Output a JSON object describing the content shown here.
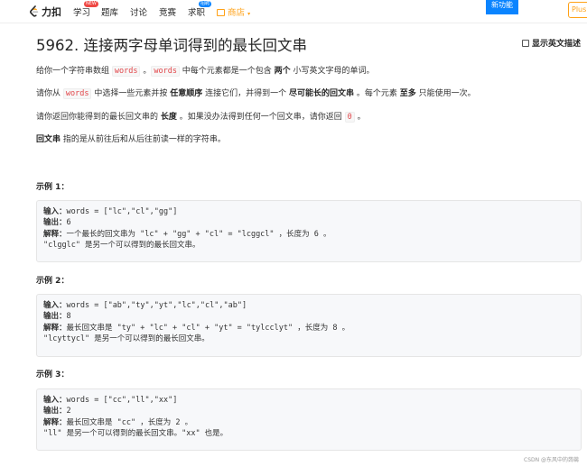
{
  "nav": {
    "logo_text": "力扣",
    "items": [
      {
        "label": "学习",
        "badge": "NEW"
      },
      {
        "label": "题库"
      },
      {
        "label": "讨论"
      },
      {
        "label": "竞赛"
      },
      {
        "label": "求职",
        "badge": "招聘"
      },
      {
        "label": "商店"
      }
    ],
    "new_feature": "新功能",
    "plus": "Plus"
  },
  "problem": {
    "title": "5962. 连接两字母单词得到的最长回文串",
    "show_english": "显示英文描述",
    "desc": {
      "p1_a": "给你一个字符串数组 ",
      "p1_code1": "words",
      "p1_b": " 。",
      "p1_code2": "words",
      "p1_c": " 中每个元素都是一个包含 ",
      "p1_bold": "两个",
      "p1_d": " 小写英文字母的单词。",
      "p2_a": "请你从 ",
      "p2_code": "words",
      "p2_b": " 中选择一些元素并按 ",
      "p2_bold1": "任意顺序",
      "p2_c": " 连接它们，并得到一个 ",
      "p2_bold2": "尽可能长的回文串",
      "p2_d": " 。每个元素 ",
      "p2_bold3": "至多",
      "p2_e": " 只能使用一次。",
      "p3_a": "请你返回你能得到的最长回文串的 ",
      "p3_bold": "长度",
      "p3_b": " 。如果没办法得到任何一个回文串，请你返回 ",
      "p3_code": "0",
      "p3_c": " 。",
      "p4_bold": "回文串",
      "p4_a": " 指的是从前往后和从后往前读一样的字符串。"
    },
    "examples": [
      {
        "label": "示例 1：",
        "input_label": "输入：",
        "input": "words = [\"lc\",\"cl\",\"gg\"]",
        "output_label": "输出：",
        "output": "6",
        "explain_label": "解释：",
        "explain": "一个最长的回文串为 \"lc\" + \"gg\" + \"cl\" = \"lcggcl\" ，长度为 6 。",
        "extra": "\"clgglc\" 是另一个可以得到的最长回文串。"
      },
      {
        "label": "示例 2：",
        "input_label": "输入：",
        "input": "words = [\"ab\",\"ty\",\"yt\",\"lc\",\"cl\",\"ab\"]",
        "output_label": "输出：",
        "output": "8",
        "explain_label": "解释：",
        "explain": "最长回文串是 \"ty\" + \"lc\" + \"cl\" + \"yt\" = \"tylcclyt\" ，长度为 8 。",
        "extra": "\"lcyttycl\" 是另一个可以得到的最长回文串。"
      },
      {
        "label": "示例 3：",
        "input_label": "输入：",
        "input": "words = [\"cc\",\"ll\",\"xx\"]",
        "output_label": "输出：",
        "output": "2",
        "explain_label": "解释：",
        "explain": "最长回文串是 \"cc\" ，长度为 2 。",
        "extra": "\"ll\" 是另一个可以得到的最长回文串。\"xx\" 也是。"
      }
    ]
  },
  "watermark": "CSDN @东风中的蒟蒻"
}
